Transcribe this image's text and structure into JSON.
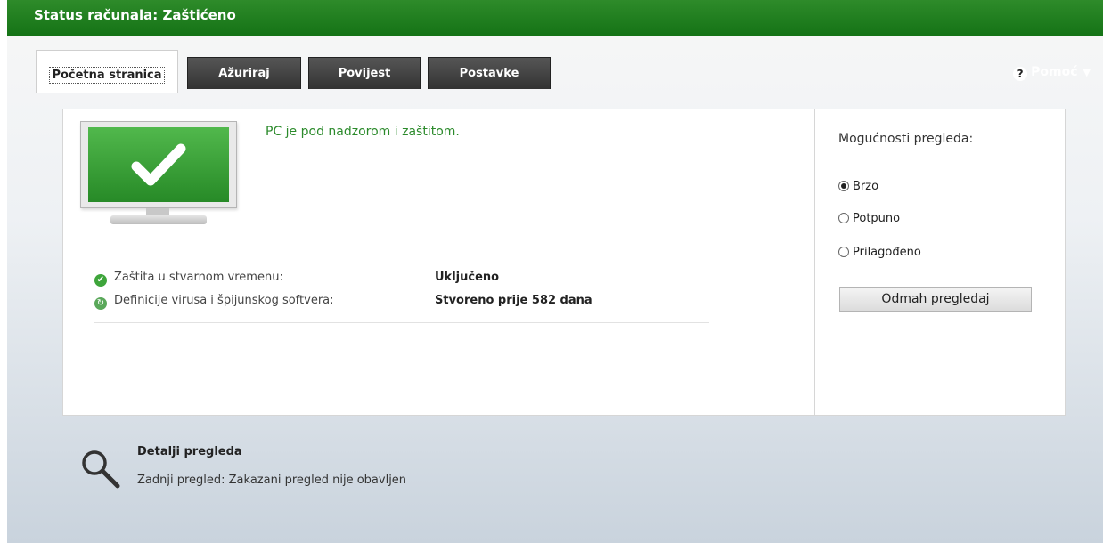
{
  "window": {
    "title": "Status računala: Zaštićeno"
  },
  "tabs": [
    {
      "label": "Početna stranica",
      "active": true
    },
    {
      "label": "Ažuriraj",
      "active": false
    },
    {
      "label": "Povijest",
      "active": false
    },
    {
      "label": "Postavke",
      "active": false
    }
  ],
  "help": {
    "label": "Pomoć",
    "icon": "question-circle-icon"
  },
  "status": {
    "message": "PC je pod nadzorom i zaštitom.",
    "icon": "monitor-checkmark-icon",
    "rows": [
      {
        "label": "Zaštita u stvarnom vremenu:",
        "value": "Uključeno",
        "icon": "check-circle-icon"
      },
      {
        "label": "Definicije virusa i špijunskog softvera:",
        "value": "Stvoreno prije 582 dana",
        "icon": "update-circle-icon"
      }
    ]
  },
  "scan_options": {
    "title": "Mogućnosti pregleda:",
    "options": [
      {
        "label": "Brzo",
        "selected": true
      },
      {
        "label": "Potpuno",
        "selected": false
      },
      {
        "label": "Prilagođeno",
        "selected": false
      }
    ],
    "scan_button": "Odmah pregledaj"
  },
  "scan_details": {
    "title": "Detalji pregleda",
    "last_scan": "Zadnji pregled:  Zakazani pregled nije obavljen",
    "icon": "magnifier-icon"
  },
  "colors": {
    "titlebar": "#1f7f1f",
    "status_green": "#2b8a2b",
    "screen_green": "#3ea53b"
  }
}
